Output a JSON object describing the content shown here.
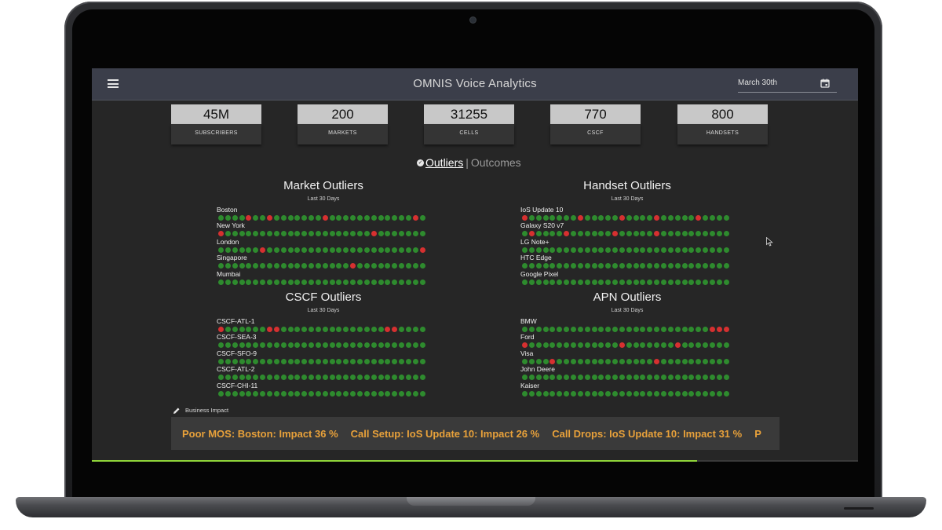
{
  "app": {
    "title": "OMNIS Voice Analytics",
    "date": "March 30th",
    "menu_icon": "hamburger-menu-icon",
    "calendar_icon": "calendar-icon"
  },
  "stats": [
    {
      "value": "45M",
      "label": "SUBSCRIBERS"
    },
    {
      "value": "200",
      "label": "MARKETS"
    },
    {
      "value": "31255",
      "label": "CELLS"
    },
    {
      "value": "770",
      "label": "CSCF"
    },
    {
      "value": "800",
      "label": "HANDSETS"
    }
  ],
  "view_toggle": {
    "active": "Outliers",
    "separator": "|",
    "inactive": "Outcomes"
  },
  "colors": {
    "ok": "#2e8b2e",
    "outlier": "#d63030",
    "ticker_text": "#e8a13a",
    "progress": "#8fd43a"
  },
  "panels": {
    "market": {
      "title": "Market Outliers",
      "subtitle": "Last 30 Days",
      "rows": [
        {
          "label": "Boston",
          "red": [
            4,
            7,
            15,
            28
          ]
        },
        {
          "label": "New York",
          "red": [
            0,
            22
          ]
        },
        {
          "label": "London",
          "red": [
            6,
            29
          ]
        },
        {
          "label": "Singapore",
          "red": [
            19
          ]
        },
        {
          "label": "Mumbai",
          "red": []
        }
      ]
    },
    "handset": {
      "title": "Handset Outliers",
      "subtitle": "Last 30 Days",
      "rows": [
        {
          "label": "IoS Update 10",
          "red": [
            0,
            8,
            14,
            19,
            25
          ]
        },
        {
          "label": "Galaxy S20 v7",
          "red": [
            1,
            6,
            13,
            19
          ]
        },
        {
          "label": "LG Note+",
          "red": []
        },
        {
          "label": "HTC Edge",
          "red": []
        },
        {
          "label": "Google Pixel",
          "red": []
        }
      ]
    },
    "cscf": {
      "title": "CSCF Outliers",
      "subtitle": "Last 30 Days",
      "rows": [
        {
          "label": "CSCF-ATL-1",
          "red": [
            0,
            7,
            8,
            24,
            25
          ]
        },
        {
          "label": "CSCF-SEA-3",
          "red": []
        },
        {
          "label": "CSCF-SFO-9",
          "red": []
        },
        {
          "label": "CSCF-ATL-2",
          "red": []
        },
        {
          "label": "CSCF-CHI-11",
          "red": []
        }
      ]
    },
    "apn": {
      "title": "APN Outliers",
      "subtitle": "Last 30 Days",
      "rows": [
        {
          "label": "BMW",
          "red": [
            27,
            28,
            29
          ]
        },
        {
          "label": "Ford",
          "red": [
            0,
            14,
            22
          ]
        },
        {
          "label": "Visa",
          "red": [
            4,
            19
          ]
        },
        {
          "label": "John Deere",
          "red": []
        },
        {
          "label": "Kaiser",
          "red": []
        }
      ]
    }
  },
  "business_impact": {
    "label": "Business Impact",
    "icon": "pencil-icon",
    "items": [
      "Poor MOS: Boston: Impact 36 %",
      "Call Setup: IoS Update 10: Impact 26 %",
      "Call Drops: IoS Update 10: Impact 31 %",
      "P"
    ]
  },
  "playback_progress": 0.79
}
